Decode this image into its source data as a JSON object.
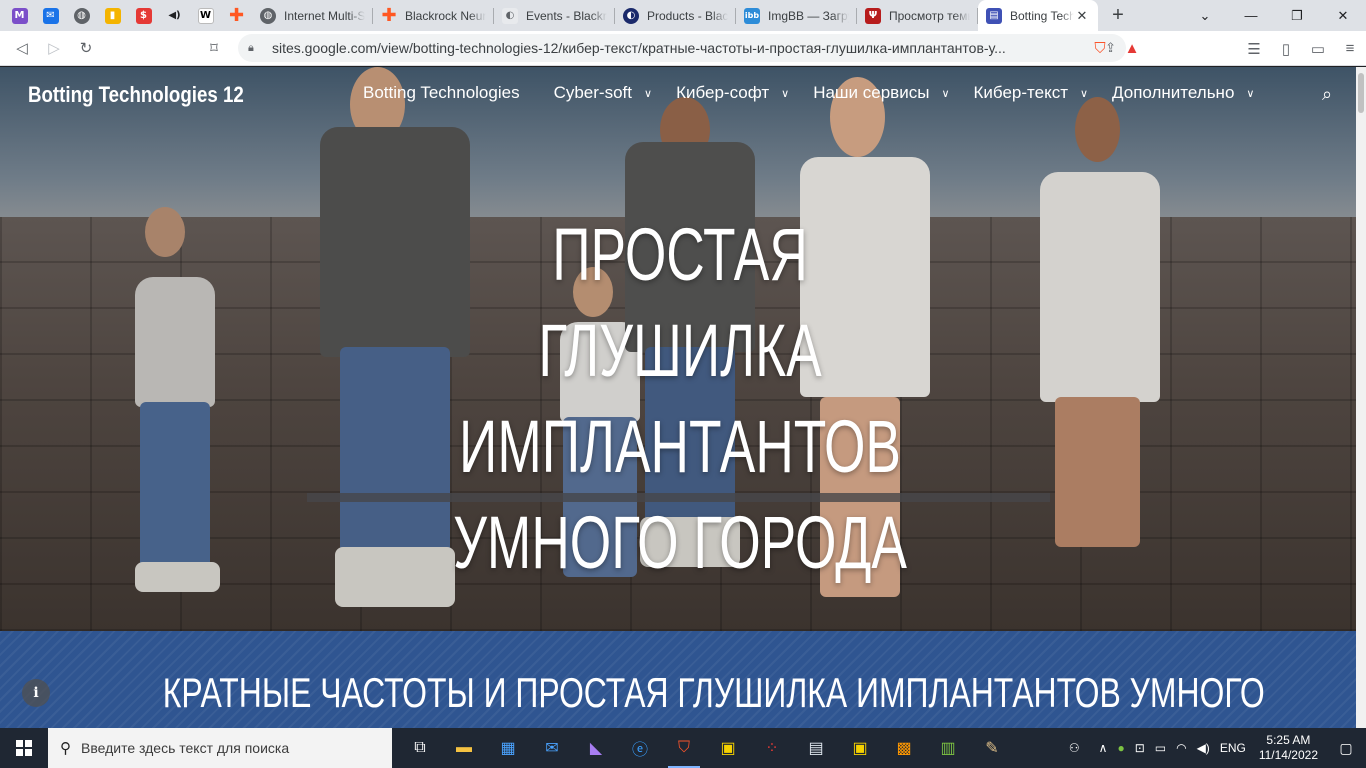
{
  "browser": {
    "tabs": [
      {
        "title": "Internet Multi-S",
        "icon": "globe-icon"
      },
      {
        "title": "Blackrock Neuro",
        "icon": "plus-icon"
      },
      {
        "title": "Events - Blackro",
        "icon": "page-icon"
      },
      {
        "title": "Products - Black",
        "icon": "circle-icon"
      },
      {
        "title": "ImgBB — Загру",
        "icon": "ibb-icon"
      },
      {
        "title": "Просмотр темы",
        "icon": "psi-icon"
      },
      {
        "title": "Botting Tech",
        "icon": "sites-icon",
        "active": true
      }
    ],
    "pinned_icons": [
      "mail-icon",
      "email-icon",
      "globe-icon",
      "chart-icon",
      "bank-icon",
      "speaker-icon",
      "wikipedia-icon",
      "plus-icon"
    ],
    "wiki_glyph": "W",
    "close_glyph": "✕",
    "new_tab_glyph": "+",
    "url": "sites.google.com/view/botting-technologies-12/кибер-текст/кратные-частоты-и-простая-глушилка-имплантантов-у..."
  },
  "site": {
    "name": "Botting Technologies 12",
    "nav": [
      {
        "label": "Botting Technologies",
        "dropdown": false
      },
      {
        "label": "Cyber-soft",
        "dropdown": true
      },
      {
        "label": "Кибер-софт",
        "dropdown": true
      },
      {
        "label": "Наши сервисы",
        "dropdown": true
      },
      {
        "label": "Кибер-текст",
        "dropdown": true
      },
      {
        "label": "Дополнительно",
        "dropdown": true
      }
    ],
    "hero_title_lines": [
      "ПРОСТАЯ ГЛУШИЛКА",
      "ИМПЛАНТАНТОВ",
      "УМНОГО ГОРОДА"
    ],
    "section_title": "КРАТНЫЕ ЧАСТОТЫ И ПРОСТАЯ ГЛУШИЛКА ИМПЛАНТАНТОВ УМНОГО",
    "info_glyph": "i"
  },
  "taskbar": {
    "search_placeholder": "Введите здесь текст для поиска",
    "language": "ENG",
    "time": "5:25 AM",
    "date": "11/14/2022"
  },
  "colors": {
    "band": "#2f5591",
    "active_tab": "#ffffff",
    "tabstrip": "#dee1e6",
    "taskbar": "#1f2733"
  }
}
